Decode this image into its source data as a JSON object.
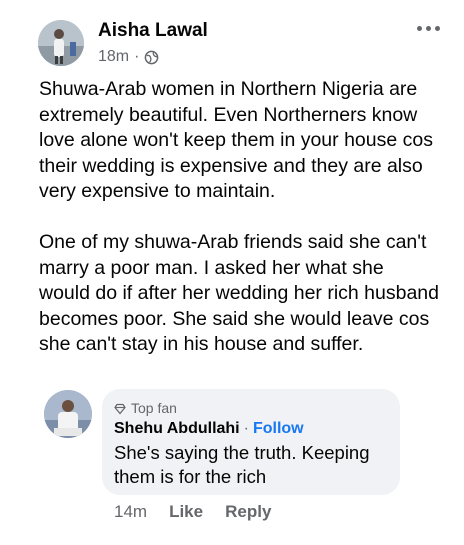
{
  "post": {
    "author": "Aisha Lawal",
    "time": "18m",
    "separator": "·",
    "privacy_icon": "globe-icon",
    "more_icon": "more-options-icon",
    "paragraphs": [
      "Shuwa-Arab women in Northern Nigeria are extremely beautiful. Even Northerners know love alone won't keep them in your house cos their wedding is expensive and they are also very expensive to maintain.",
      "One of my shuwa-Arab friends said she can't marry a poor man. I asked her what she would do if after her wedding her rich husband becomes poor. She said she would leave cos she can't stay in his house and suffer."
    ]
  },
  "comment": {
    "badge": "Top fan",
    "badge_icon": "diamond-icon",
    "author": "Shehu Abdullahi",
    "separator": "·",
    "follow_label": "Follow",
    "text": "She's saying the truth. Keeping them is for the rich",
    "time": "14m",
    "like_label": "Like",
    "reply_label": "Reply"
  },
  "colors": {
    "text": "#050505",
    "secondary": "#65676b",
    "link": "#1877f2",
    "bubble": "#f0f2f5"
  }
}
